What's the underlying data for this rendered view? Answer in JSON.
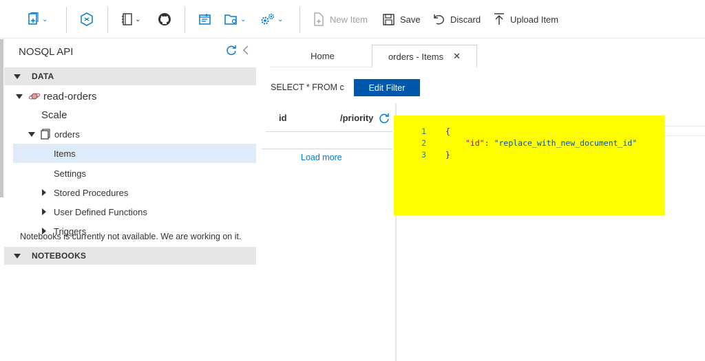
{
  "toolbar": {
    "new_item": "New Item",
    "save": "Save",
    "discard": "Discard",
    "upload_item": "Upload Item"
  },
  "sidebar": {
    "title": "NOSQL API",
    "data_section": "DATA",
    "database": "read-orders",
    "scale": "Scale",
    "container": "orders",
    "items": [
      {
        "label": "Items"
      },
      {
        "label": "Settings"
      },
      {
        "label": "Stored Procedures"
      },
      {
        "label": "User Defined Functions"
      },
      {
        "label": "Triggers"
      }
    ],
    "notebooks_section": "NOTEBOOKS",
    "notebooks_message": "Notebooks is currently not available. We are working on it."
  },
  "tabs": [
    {
      "label": "Home"
    },
    {
      "label": "orders - Items"
    }
  ],
  "query": {
    "text": "SELECT * FROM c",
    "edit_filter": "Edit Filter"
  },
  "list": {
    "col_id": "id",
    "col_partition": "/priority",
    "load_more": "Load more"
  },
  "editor": {
    "lines": [
      {
        "num": "1",
        "text": "{"
      },
      {
        "num": "2",
        "key": "\"id\"",
        "sep": ": ",
        "value": "\"replace_with_new_document_id\""
      },
      {
        "num": "3",
        "text": "}"
      }
    ],
    "highlight_color": "#ffff00"
  },
  "colors": {
    "accent": "#0078d4",
    "button": "#0058ad",
    "selected": "#deecf9"
  }
}
